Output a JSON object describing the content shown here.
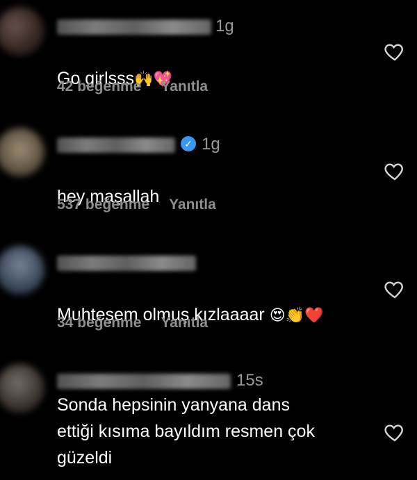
{
  "comments": [
    {
      "time": "1g",
      "text": "Go girlsss",
      "emojis": "🙌💖",
      "likes": "42 beğenme",
      "reply": "Yanıtla",
      "verified": false
    },
    {
      "time": "1g",
      "text": "hey maşallah",
      "emojis": "",
      "likes": "537 beğenme",
      "reply": "Yanıtla",
      "verified": true
    },
    {
      "time": "",
      "text": "Muhteşem olmuş kızlaaaar",
      "emojis": "😍👏❤️",
      "likes": "34 beğenme",
      "reply": "Yanıtla",
      "verified": false
    },
    {
      "time": "15s",
      "text": "Sonda hepsinin yanyana dans\nettiği kısıma bayıldım resmen çok\ngüzeldi",
      "emojis": "",
      "likes": "",
      "reply": "",
      "verified": false
    }
  ],
  "icons": {
    "like": "heart-outline-icon",
    "verified": "verified-badge-icon"
  },
  "colors": {
    "background": "#000000",
    "secondary_text": "#8e8e8e",
    "verified": "#3897f0"
  }
}
